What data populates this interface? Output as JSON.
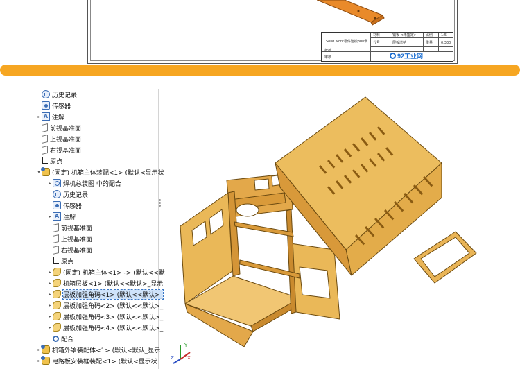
{
  "drawing": {
    "title_block": {
      "drawing_title": "Solid work零件建模800例",
      "row2_left": "校核",
      "row3_left": "审核",
      "material_label": "材料",
      "material_value": "钢板 <未指定>",
      "code_label": "代号",
      "code_value": "层板增护",
      "scale_label": "比例",
      "scale_value": "1:5",
      "weight_label": "重量",
      "weight_value": "0.330"
    },
    "logo_text": "92工业网"
  },
  "tree": {
    "items": [
      {
        "label": "历史记录",
        "icon": "history-icon",
        "indent": 0,
        "expand": ""
      },
      {
        "label": "传感器",
        "icon": "sensor-icon",
        "indent": 0,
        "expand": ""
      },
      {
        "label": "注解",
        "icon": "annotation-icon",
        "indent": 0,
        "expand": "▸"
      },
      {
        "label": "前视基准面",
        "icon": "plane-icon",
        "indent": 0,
        "expand": ""
      },
      {
        "label": "上视基准面",
        "icon": "plane-icon",
        "indent": 0,
        "expand": ""
      },
      {
        "label": "右视基准面",
        "icon": "plane-icon",
        "indent": 0,
        "expand": ""
      },
      {
        "label": "原点",
        "icon": "origin-icon",
        "indent": 0,
        "expand": ""
      },
      {
        "label": "(固定) 机箱主体装配<1> (默认<显示状",
        "icon": "assembly-icon",
        "indent": 0,
        "expand": "▾"
      },
      {
        "label": "焊机总装图 中的配合",
        "icon": "mate-group-icon",
        "indent": 1,
        "expand": "▸"
      },
      {
        "label": "历史记录",
        "icon": "history-icon",
        "indent": 1,
        "expand": ""
      },
      {
        "label": "传感器",
        "icon": "sensor-icon",
        "indent": 1,
        "expand": ""
      },
      {
        "label": "注解",
        "icon": "annotation-icon",
        "indent": 1,
        "expand": "▸"
      },
      {
        "label": "前视基准面",
        "icon": "plane-icon",
        "indent": 1,
        "expand": ""
      },
      {
        "label": "上视基准面",
        "icon": "plane-icon",
        "indent": 1,
        "expand": ""
      },
      {
        "label": "右视基准面",
        "icon": "plane-icon",
        "indent": 1,
        "expand": ""
      },
      {
        "label": "原点",
        "icon": "origin-icon",
        "indent": 1,
        "expand": ""
      },
      {
        "label": "(固定) 机箱主体<1> -> (默认<<默",
        "icon": "part-icon",
        "indent": 1,
        "expand": "▸"
      },
      {
        "label": "机箱层板<1> (默认<<默认>_显示",
        "icon": "part-icon",
        "indent": 1,
        "expand": "▸"
      },
      {
        "label": "层板加强角码<1> (默认<<默认>_",
        "icon": "part-icon",
        "indent": 1,
        "expand": "▸",
        "selected": true
      },
      {
        "label": "层板加强角码<2> (默认<<默认>_",
        "icon": "part-icon",
        "indent": 1,
        "expand": "▸"
      },
      {
        "label": "层板加强角码<3> (默认<<默认>_",
        "icon": "part-icon",
        "indent": 1,
        "expand": "▸"
      },
      {
        "label": "层板加强角码<4> (默认<<默认>_",
        "icon": "part-icon",
        "indent": 1,
        "expand": "▸"
      },
      {
        "label": "配合",
        "icon": "mates-icon",
        "indent": 1,
        "expand": ""
      },
      {
        "label": "机箱外罩装配体<1> (默认<默认_显示",
        "icon": "assembly-icon",
        "indent": 0,
        "expand": "▸"
      },
      {
        "label": "电路板安装框装配<1> (默认<显示状",
        "icon": "assembly-icon",
        "indent": 0,
        "expand": "▸"
      }
    ]
  },
  "viewport": {
    "part_color": "#e8b34c",
    "edge_color": "#6b4a10",
    "triad_labels": {
      "x": "X",
      "y": "Y",
      "z": "Z"
    }
  },
  "colors": {
    "separator": "#f6a622",
    "selection": "#cfe3fa",
    "accent": "#3b6db5"
  }
}
